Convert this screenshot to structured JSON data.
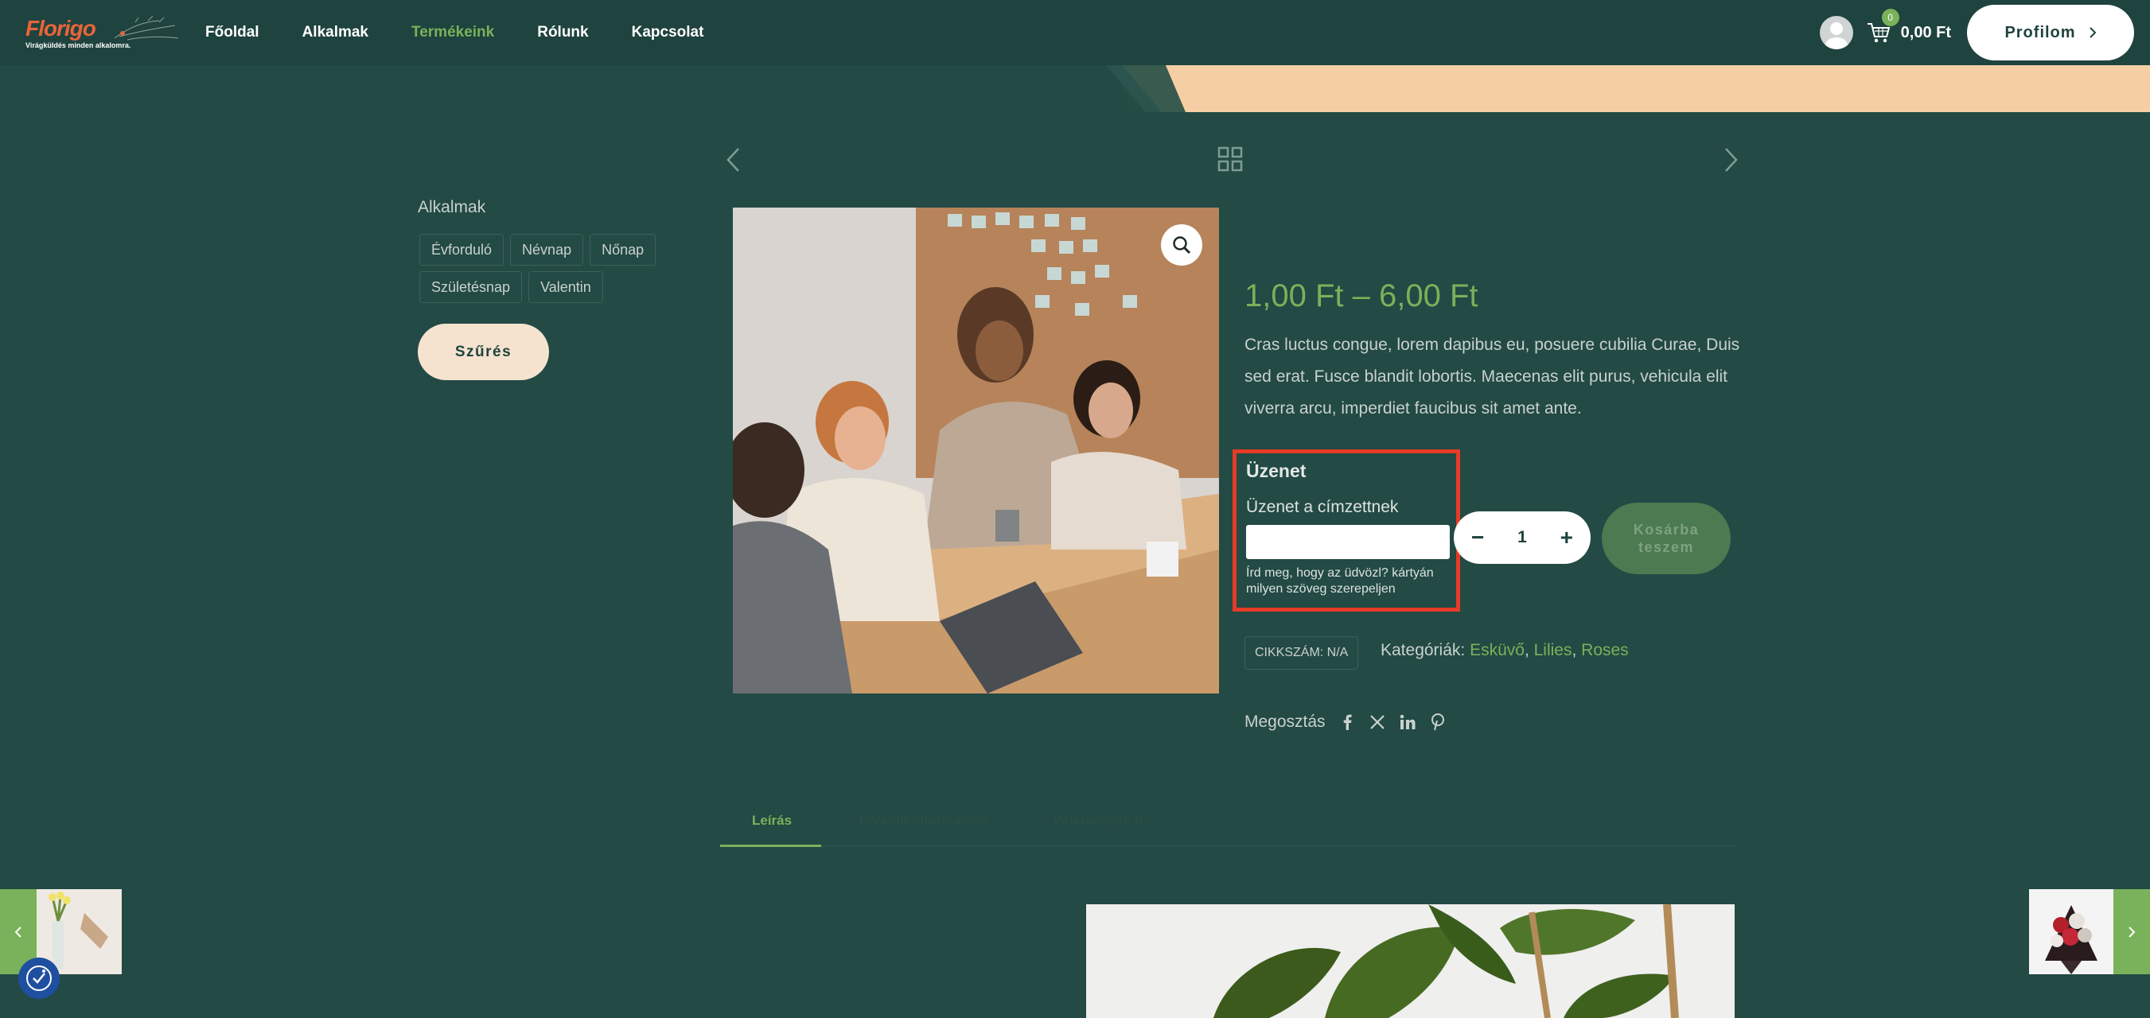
{
  "header": {
    "logo": {
      "word": "Florigo",
      "tagline": "Virágküldés minden alkalomra."
    },
    "nav": [
      {
        "label": "Főoldal",
        "active": false
      },
      {
        "label": "Alkalmak",
        "active": false
      },
      {
        "label": "Termékeink",
        "active": true
      },
      {
        "label": "Rólunk",
        "active": false
      },
      {
        "label": "Kapcsolat",
        "active": false
      }
    ],
    "cart": {
      "count": "0",
      "total": "0,00 Ft",
      "icon": "cart-icon"
    },
    "profile_label": "Profilom"
  },
  "sidebar": {
    "title": "Alkalmak",
    "tags": [
      "Évforduló",
      "Névnap",
      "Nőnap",
      "Születésnap",
      "Valentin"
    ],
    "filter_label": "Szűrés"
  },
  "product": {
    "price": "1,00 Ft – 6,00 Ft",
    "description": "Cras luctus congue, lorem dapibus eu, posuere cubilia Curae, Duis sed erat. Fusce blandit lobortis. Maecenas elit purus, vehicula elit viverra arcu, imperdiet faucibus sit amet ante.",
    "message": {
      "title": "Üzenet",
      "label": "Üzenet a címzettnek",
      "value": "",
      "hint": "Írd meg, hogy az üdvözl? kártyán milyen szöveg szerepeljen"
    },
    "quantity": "1",
    "add_to_cart": "Kosárba teszem",
    "sku": "CIKKSZÁM: N/A",
    "categories_label": "Kategóriák:",
    "categories": [
      "Esküvő",
      "Lilies",
      "Roses"
    ],
    "share_label": "Megosztás"
  },
  "tabs": [
    {
      "label": "Leírás",
      "active": true
    },
    {
      "label": "További információk",
      "active": false
    },
    {
      "label": "Vélemények 0",
      "active": false
    }
  ],
  "colors": {
    "background": "#234a44",
    "header": "#1f433e",
    "accent_green": "#79b25a",
    "peach": "#f5e3cf",
    "highlight_red": "#e53b27"
  }
}
